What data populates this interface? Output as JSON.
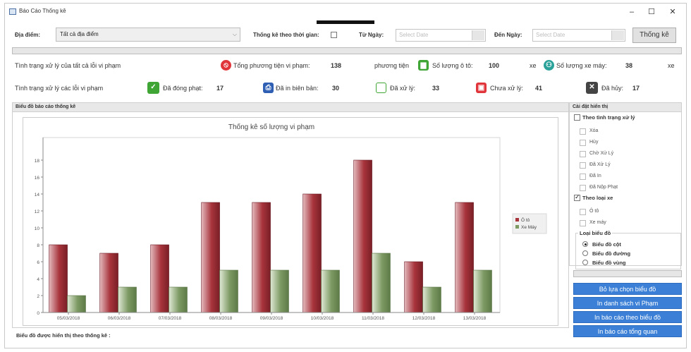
{
  "window": {
    "title": "Báo Cáo Thống kê",
    "controls": [
      "–",
      "☐",
      "✕"
    ]
  },
  "toolbar": {
    "location_label": "Địa điểm:",
    "location_value": "Tất cả địa điểm",
    "time_stat_label": "Thống kê theo thời gian:",
    "time_stat_checked": false,
    "from_label": "Từ Ngày:",
    "from_placeholder": "Select Date",
    "to_label": "Đến Ngày:",
    "to_placeholder": "Select Date",
    "stat_button": "Thống kê"
  },
  "summary": {
    "row1_label": "Tình trạng xử lý của tất cả lỗi vi phạm",
    "total_label": "Tổng phương tiện vi phạm:",
    "total_value": "138",
    "total_unit": "phương tiện",
    "cars_label": "Số lượng ô tô:",
    "cars_value": "100",
    "cars_unit": "xe",
    "motos_label": "Số lượng xe máy:",
    "motos_value": "38",
    "motos_unit": "xe",
    "row2_label": "Tình trạng xử lý các lỗi vi phạm",
    "fined_label": "Đã đóng phạt:",
    "fined_value": "17",
    "printed_label": "Đã in biên bản:",
    "printed_value": "30",
    "processed_label": "Đã xử lý:",
    "processed_value": "33",
    "unprocessed_label": "Chưa xử lý:",
    "unprocessed_value": "41",
    "cancelled_label": "Đã hủy:",
    "cancelled_value": "17",
    "colors": {
      "red": "#e0353b",
      "green": "#3fa535",
      "blue": "#2f5fb3",
      "dark": "#444444"
    }
  },
  "chart_panel": {
    "header": "Biểu đồ báo cáo thống kê"
  },
  "chart_data": {
    "type": "bar",
    "title": "Thống kê số lượng vi phạm",
    "categories": [
      "05/03/2018",
      "06/03/2018",
      "07/03/2018",
      "08/03/2018",
      "09/03/2018",
      "10/03/2018",
      "11/03/2018",
      "12/03/2018",
      "13/03/2018"
    ],
    "series": [
      {
        "name": "Ô tô",
        "values": [
          8,
          7,
          8,
          13,
          13,
          14,
          18,
          6,
          13
        ],
        "color": "#a8343c"
      },
      {
        "name": "Xe Máy",
        "values": [
          2,
          3,
          3,
          5,
          5,
          5,
          7,
          3,
          5
        ],
        "color": "#7d9a63"
      }
    ],
    "ylim": [
      0,
      20
    ],
    "yticks": [
      0,
      2,
      4,
      6,
      8,
      10,
      12,
      14,
      16,
      18
    ],
    "legend_position": "right",
    "grid": false
  },
  "settings": {
    "header": "Cài đặt hiển thị",
    "by_status_label": "Theo tình trạng xử lý",
    "by_status_checked": false,
    "status_items": [
      "Xóa",
      "Hủy",
      "Chờ Xử Lý",
      "Đã Xử Lý",
      "Đã In",
      "Đã Nộp Phạt"
    ],
    "by_vehicle_label": "Theo loại xe",
    "by_vehicle_checked": true,
    "vehicle_items": [
      "Ô tô",
      "Xe máy"
    ],
    "chart_type_label": "Loại biểu đồ",
    "chart_types": [
      "Biểu đồ cột",
      "Biểu đồ đường",
      "Biểu đồ vùng"
    ],
    "chart_type_selected": 0
  },
  "actions": {
    "deselect": "Bỏ lựa chọn biểu đồ",
    "print_list": "In danh sách vi Phạm",
    "print_chart": "In báo cáo theo biểu đồ",
    "print_overview": "In báo cáo tổng quan"
  },
  "footer": {
    "label": "Biểu đồ được hiển thị theo thống kê :"
  }
}
